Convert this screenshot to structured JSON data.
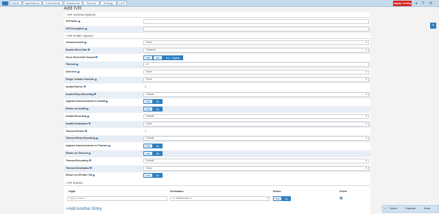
{
  "nav": {
    "items": [
      "Admin",
      "Applications",
      "Connectivity",
      "Dashboard",
      "Reports",
      "Settings",
      "UCP"
    ],
    "apply_label": "Apply Config"
  },
  "page": {
    "title": "Add IVR"
  },
  "sections": {
    "general": "IVR General Options",
    "dtmf": "IVR DTMF Options",
    "entries": "IVR Entries"
  },
  "general": [
    {
      "label": "IVR Name",
      "value": ""
    },
    {
      "label": "IVR Description",
      "value": ""
    }
  ],
  "dtmf": [
    {
      "label": "Announcement",
      "kind": "select",
      "value": "None"
    },
    {
      "label": "Enable Direct Dial",
      "kind": "select",
      "value": "Disabled"
    },
    {
      "label": "Force Strict Dial Timeout",
      "kind": "buttons",
      "options": [
        "Yes",
        "No",
        "No - Legacy"
      ],
      "selected": 2
    },
    {
      "label": "Timeout",
      "kind": "text",
      "value": "10"
    },
    {
      "label": "Alert Info",
      "kind": "select",
      "value": "None"
    },
    {
      "label": "Ringer Volume Override",
      "kind": "select",
      "value": "None"
    },
    {
      "label": "Invalid Retries",
      "kind": "plain",
      "value": "3"
    },
    {
      "label": "Invalid Retry Recording",
      "kind": "select",
      "value": "Default"
    },
    {
      "label": "Append Announcement to Invalid",
      "kind": "buttons",
      "options": [
        "Yes",
        "No"
      ],
      "selected": 1
    },
    {
      "label": "Return on Invalid",
      "kind": "buttons",
      "options": [
        "Yes",
        "No"
      ],
      "selected": 1
    },
    {
      "label": "Invalid Recording",
      "kind": "select",
      "value": "Default"
    },
    {
      "label": "Invalid Destination",
      "kind": "select",
      "value": "None"
    },
    {
      "label": "Timeout Retries",
      "kind": "plain",
      "value": "3"
    },
    {
      "label": "Timeout Retry Recording",
      "kind": "select",
      "value": "Default"
    },
    {
      "label": "Append Announcement on Timeout",
      "kind": "buttons",
      "options": [
        "Yes",
        "No"
      ],
      "selected": 1
    },
    {
      "label": "Return on Timeout",
      "kind": "buttons",
      "options": [
        "Yes",
        "No"
      ],
      "selected": 1
    },
    {
      "label": "Timeout Recording",
      "kind": "select",
      "value": "Default"
    },
    {
      "label": "Timeout Destination",
      "kind": "select",
      "value": "None"
    },
    {
      "label": "Return to IVR after VM",
      "kind": "buttons",
      "options": [
        "Yes",
        "No"
      ],
      "selected": 1
    }
  ],
  "entries": {
    "headers": [
      "Digits",
      "Destination",
      "Return",
      "Delete"
    ],
    "digits_placeholder": "digits pressed",
    "destination_value": "== choose one ==",
    "return_options": [
      "Yes",
      "No"
    ],
    "add_label": "Add Another Entry"
  },
  "footer": {
    "buttons": [
      "Submit",
      "Duplicate",
      "Reset"
    ]
  }
}
